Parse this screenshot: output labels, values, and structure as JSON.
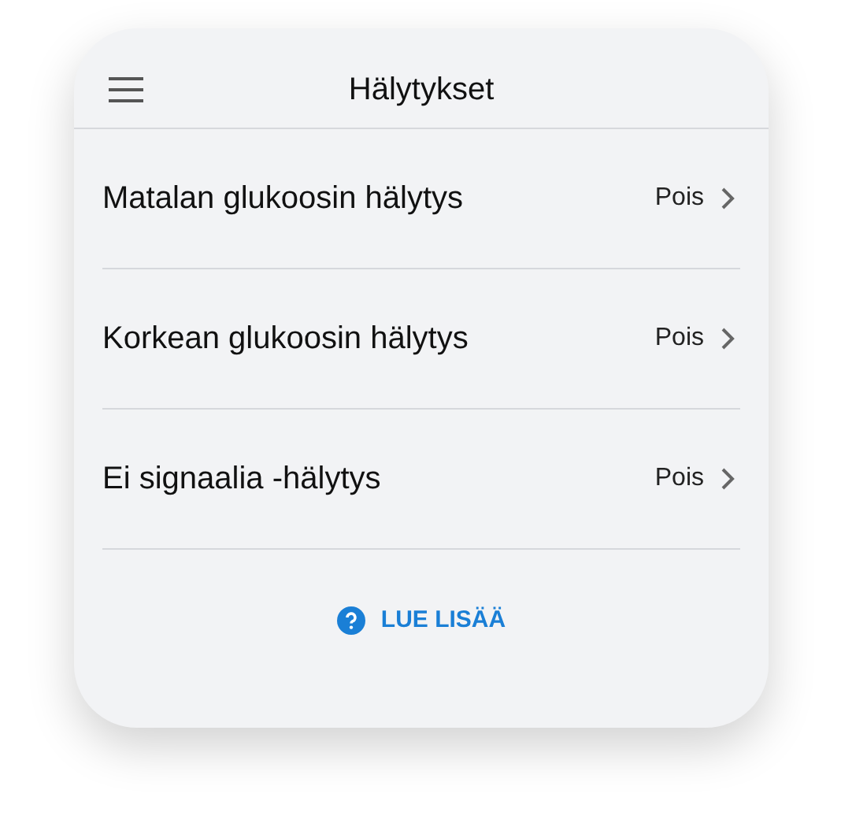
{
  "header": {
    "title": "Hälytykset"
  },
  "alarms": [
    {
      "label": "Matalan glukoosin hälytys",
      "value": "Pois"
    },
    {
      "label": "Korkean glukoosin hälytys",
      "value": "Pois"
    },
    {
      "label": "Ei signaalia -hälytys",
      "value": "Pois"
    }
  ],
  "link": {
    "label": "LUE LISÄÄ"
  }
}
